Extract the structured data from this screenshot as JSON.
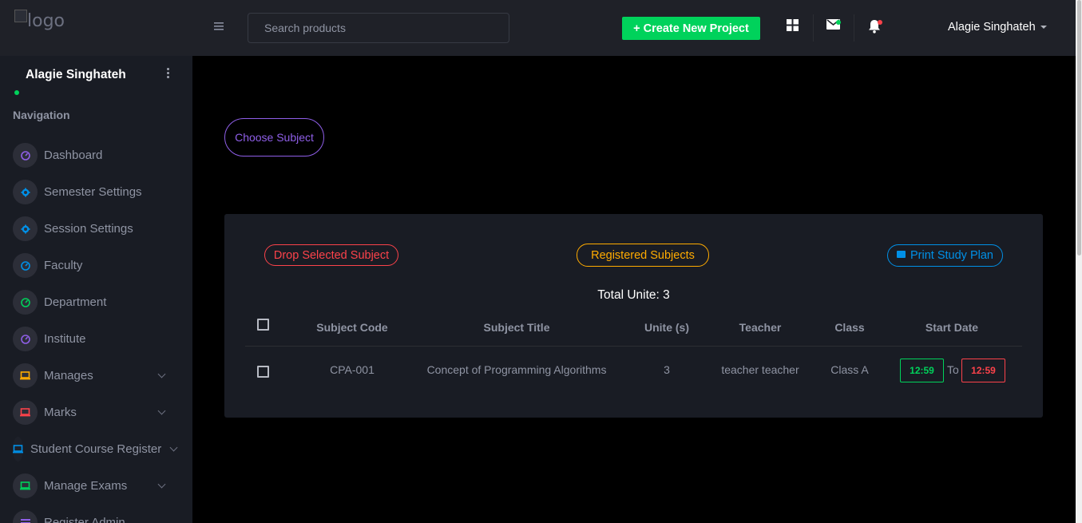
{
  "header": {
    "logo_alt": "logo",
    "search_placeholder": "Search products",
    "create_label": "+ Create New Project",
    "user_name": "Alagie Singhateh"
  },
  "sidebar": {
    "user_name": "Alagie Singhateh",
    "heading": "Navigation",
    "items": [
      {
        "label": "Dashboard",
        "icon": "speedometer-icon",
        "color": "#8f5fe8",
        "expandable": false
      },
      {
        "label": "Semester Settings",
        "icon": "gear-icon",
        "color": "#0090e7",
        "expandable": false
      },
      {
        "label": "Session Settings",
        "icon": "gear-icon",
        "color": "#0090e7",
        "expandable": false
      },
      {
        "label": "Faculty",
        "icon": "speedometer-icon",
        "color": "#0090e7",
        "expandable": false
      },
      {
        "label": "Department",
        "icon": "speedometer-icon",
        "color": "#00d25b",
        "expandable": false
      },
      {
        "label": "Institute",
        "icon": "speedometer-icon",
        "color": "#8f5fe8",
        "expandable": false
      },
      {
        "label": "Manages",
        "icon": "laptop-icon",
        "color": "#ffab00",
        "expandable": true
      },
      {
        "label": "Marks",
        "icon": "laptop-icon",
        "color": "#fc424a",
        "expandable": true
      },
      {
        "label": "Student Course Register",
        "icon": "laptop-icon",
        "color": "#0090e7",
        "expandable": true
      },
      {
        "label": "Manage Exams",
        "icon": "laptop-icon",
        "color": "#00d25b",
        "expandable": true
      },
      {
        "label": "Register Admin",
        "icon": "list-icon",
        "color": "#8f5fe8",
        "expandable": false
      }
    ]
  },
  "main": {
    "choose_subject": "Choose Subject",
    "drop_label": "Drop Selected Subject",
    "registered_label": "Registered Subjects",
    "print_label": "Print Study Plan",
    "total": "Total Unite: 3",
    "columns": [
      "Subject Code",
      "Subject Title",
      "Unite (s)",
      "Teacher",
      "Class",
      "Start Date"
    ],
    "rows": [
      {
        "code": "CPA-001",
        "title": "Concept of Programming Algorithms",
        "units": "3",
        "teacher": "teacher teacher",
        "class": "Class A",
        "start": "12:59",
        "to": "To",
        "end": "12:59"
      }
    ]
  },
  "colors": {
    "green": "#00d25b",
    "red": "#fc424a",
    "yellow": "#ffab00",
    "blue": "#0090e7",
    "purple": "#8f5fe8"
  }
}
